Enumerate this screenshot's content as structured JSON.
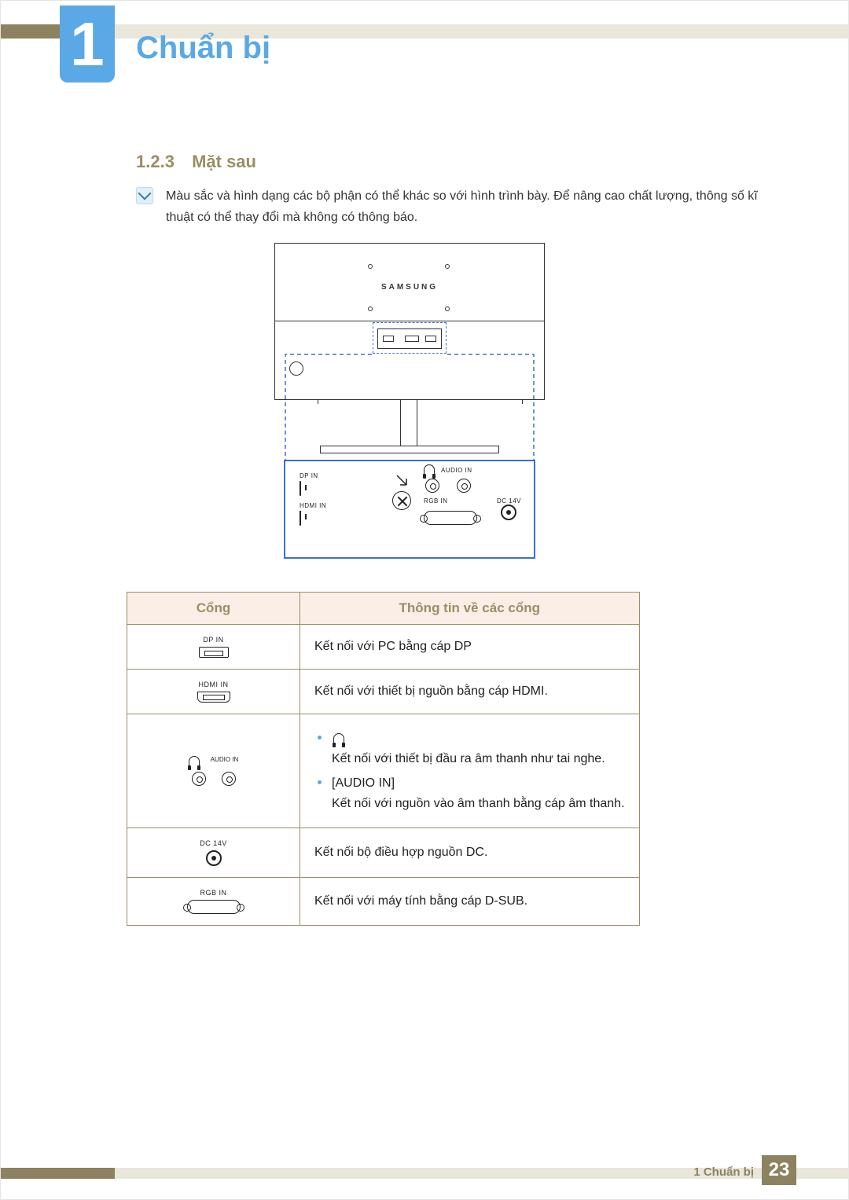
{
  "chapter": {
    "number": "1",
    "title": "Chuẩn bị"
  },
  "section": {
    "number": "1.2.3",
    "title": "Mặt sau"
  },
  "note": {
    "text": "Màu sắc và hình dạng các bộ phận có thể khác so với hình trình bày. Để nâng cao chất lượng, thông số kĩ thuật có thể thay đổi mà không có thông báo."
  },
  "diagram": {
    "brand": "SAMSUNG",
    "ports": {
      "dp_in": "DP IN",
      "hdmi_in": "HDMI IN",
      "audio_in": "AUDIO IN",
      "rgb_in": "RGB IN",
      "dc_14v": "DC 14V"
    }
  },
  "table": {
    "headers": {
      "port": "Cổng",
      "info": "Thông tin về các cổng"
    },
    "rows": {
      "dp": {
        "label": "DP IN",
        "desc": "Kết nối với PC bằng cáp DP"
      },
      "hdmi": {
        "label": "HDMI IN",
        "desc": "Kết nối với thiết bị nguồn bằng cáp HDMI."
      },
      "audio": {
        "hp_label": "",
        "audio_in_label": "AUDIO IN",
        "bullet1": "Kết nối với thiết bị đầu ra âm thanh như tai nghe.",
        "bullet2_title": "[AUDIO IN]",
        "bullet2": "Kết nối với nguồn vào âm thanh bằng cáp âm thanh."
      },
      "dc": {
        "label": "DC 14V",
        "desc": "Kết nối bộ điều hợp nguồn DC."
      },
      "rgb": {
        "label": "RGB IN",
        "desc": "Kết nối với máy tính bằng cáp D-SUB."
      }
    }
  },
  "footer": {
    "text": "1 Chuẩn bị",
    "page": "23"
  }
}
